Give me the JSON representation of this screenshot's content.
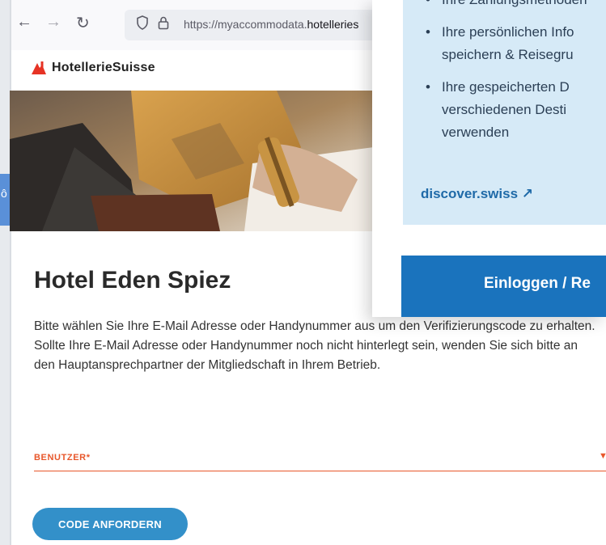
{
  "browser": {
    "url_prefix": "https://myaccommodata.",
    "url_host": "hotelleries"
  },
  "brand": {
    "name": "HotellerieSuisse"
  },
  "page": {
    "title": "Hotel Eden Spiez",
    "intro": "Bitte wählen Sie Ihre E-Mail Adresse oder Handynummer aus um den Verifizierungscode zu erhalten. Sollte Ihre E-Mail Adresse oder Handynummer noch nicht hinterlegt sein, wenden Sie sich bitte an den Hauptansprechpartner der Mitgliedschaft in Ihrem Betrieb.",
    "user_field_label": "BENUTZER*",
    "request_code_button": "CODE ANFORDERN"
  },
  "overlay": {
    "bullets": [
      "Ihre Zahlungsmethoden",
      "Ihre persönlichen Info",
      "speichern & Reisegru",
      "Ihre gespeicherten D",
      "verschiedenen Desti",
      "verwenden"
    ],
    "link_label": "discover.swiss ↗",
    "login_button": "Einloggen / Re"
  },
  "colors": {
    "accent_orange": "#e8572b",
    "button_blue": "#3390c9",
    "overlay_blue": "#1a73bd",
    "overlay_panel": "#d6eaf7"
  }
}
